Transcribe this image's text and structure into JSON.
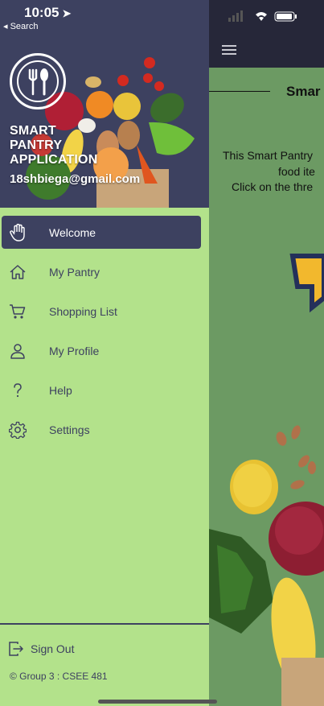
{
  "status_bar": {
    "time": "10:05",
    "back_label": "◂ Search"
  },
  "header": {
    "title_lines": [
      "SMART",
      "PANTRY",
      "APPLICATION"
    ],
    "email": "18shbiega@gmail.com"
  },
  "menu": {
    "items": [
      {
        "label": "Welcome",
        "icon": "hand-icon",
        "active": true
      },
      {
        "label": "My Pantry",
        "icon": "home-icon",
        "active": false
      },
      {
        "label": "Shopping List",
        "icon": "cart-icon",
        "active": false
      },
      {
        "label": "My Profile",
        "icon": "person-icon",
        "active": false
      },
      {
        "label": "Help",
        "icon": "question-icon",
        "active": false
      },
      {
        "label": "Settings",
        "icon": "gear-icon",
        "active": false
      }
    ]
  },
  "signout": {
    "label": "Sign Out"
  },
  "footer": {
    "text": "© Group 3 : CSEE 481"
  },
  "main": {
    "title": "Smar",
    "line1": "This Smart Pantry",
    "line2": "food ite",
    "line3": "Click on the thre"
  },
  "colors": {
    "drawer_bg": "#b3e28b",
    "header_bg": "#3d4160",
    "active_item_bg": "#3d4160",
    "main_topbar": "#262739",
    "main_bg": "#6c9a63"
  }
}
